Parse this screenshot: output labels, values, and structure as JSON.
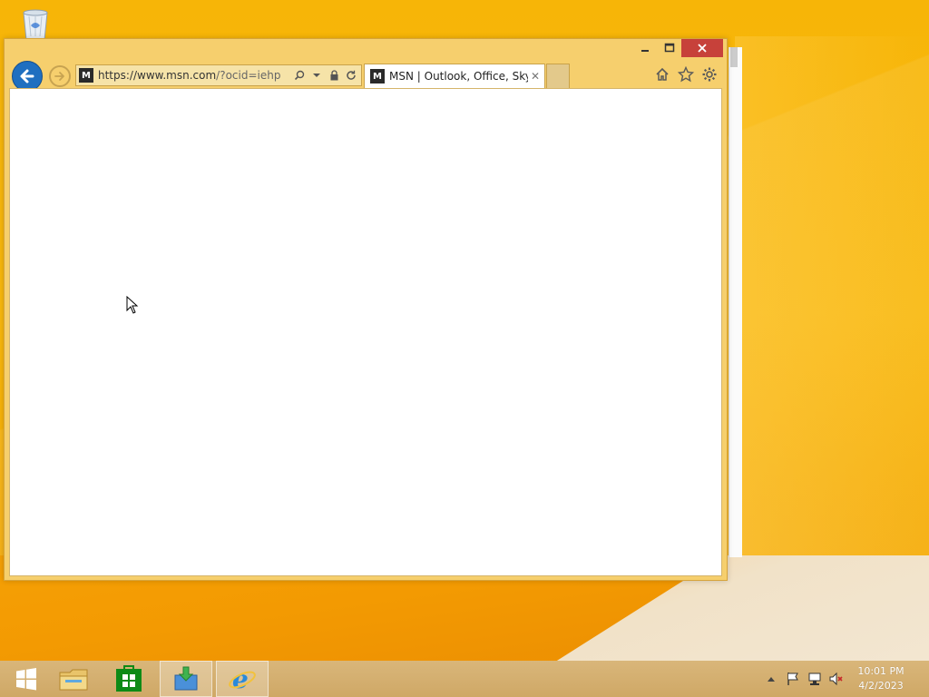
{
  "desktop": {
    "recycle_bin_icon": "recycle-bin-icon"
  },
  "browser": {
    "window_controls": {
      "minimize_icon": "minimize-icon",
      "maximize_icon": "maximize-icon",
      "close_icon": "close-icon"
    },
    "address_bar": {
      "url_host": "https://www.msn.com",
      "url_path": "/?ocid=iehp"
    },
    "tab": {
      "title": "MSN | Outlook, Office, Sky...",
      "close_glyph": "✕"
    },
    "toolbar_icons": [
      "home-icon",
      "favorites-icon",
      "settings-icon"
    ]
  },
  "taskbar": {
    "items": [
      "start-icon",
      "file-explorer-icon",
      "store-icon",
      "install-app-icon",
      "internet-explorer-icon"
    ],
    "tray_icons": [
      "show-hidden-icons",
      "action-center-flag-icon",
      "network-icon",
      "volume-muted-icon"
    ],
    "clock": {
      "time": "10:01 PM",
      "date": "4/2/2023"
    }
  }
}
